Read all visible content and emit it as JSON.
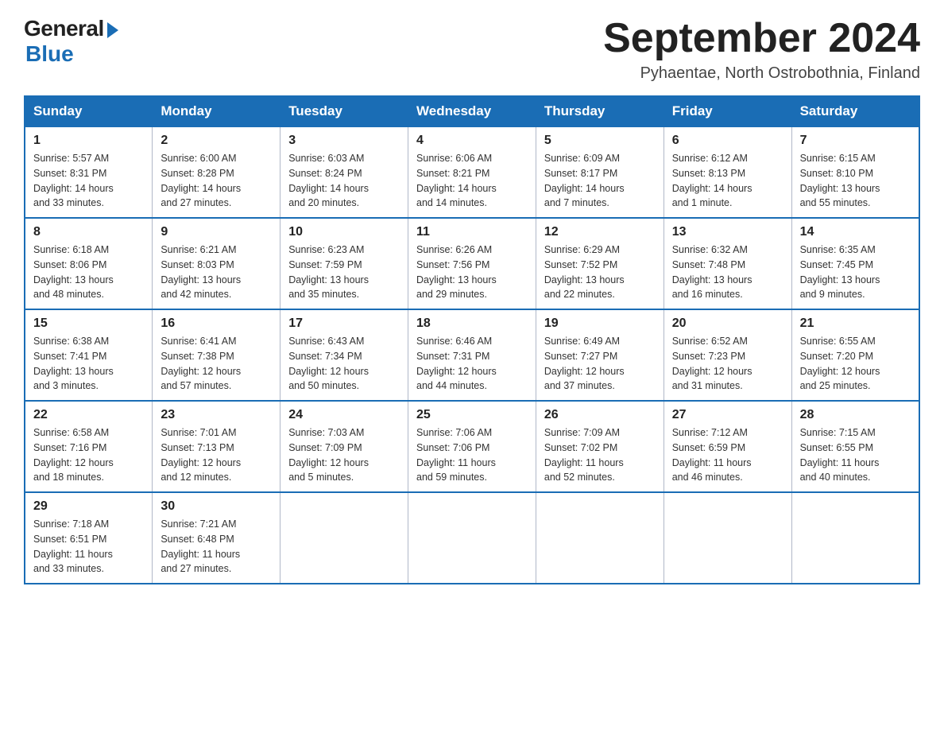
{
  "header": {
    "logo_general": "General",
    "logo_blue": "Blue",
    "month_title": "September 2024",
    "subtitle": "Pyhaentae, North Ostrobothnia, Finland"
  },
  "weekdays": [
    "Sunday",
    "Monday",
    "Tuesday",
    "Wednesday",
    "Thursday",
    "Friday",
    "Saturday"
  ],
  "weeks": [
    [
      {
        "day": "1",
        "sunrise": "Sunrise: 5:57 AM",
        "sunset": "Sunset: 8:31 PM",
        "daylight": "Daylight: 14 hours",
        "daylight2": "and 33 minutes."
      },
      {
        "day": "2",
        "sunrise": "Sunrise: 6:00 AM",
        "sunset": "Sunset: 8:28 PM",
        "daylight": "Daylight: 14 hours",
        "daylight2": "and 27 minutes."
      },
      {
        "day": "3",
        "sunrise": "Sunrise: 6:03 AM",
        "sunset": "Sunset: 8:24 PM",
        "daylight": "Daylight: 14 hours",
        "daylight2": "and 20 minutes."
      },
      {
        "day": "4",
        "sunrise": "Sunrise: 6:06 AM",
        "sunset": "Sunset: 8:21 PM",
        "daylight": "Daylight: 14 hours",
        "daylight2": "and 14 minutes."
      },
      {
        "day": "5",
        "sunrise": "Sunrise: 6:09 AM",
        "sunset": "Sunset: 8:17 PM",
        "daylight": "Daylight: 14 hours",
        "daylight2": "and 7 minutes."
      },
      {
        "day": "6",
        "sunrise": "Sunrise: 6:12 AM",
        "sunset": "Sunset: 8:13 PM",
        "daylight": "Daylight: 14 hours",
        "daylight2": "and 1 minute."
      },
      {
        "day": "7",
        "sunrise": "Sunrise: 6:15 AM",
        "sunset": "Sunset: 8:10 PM",
        "daylight": "Daylight: 13 hours",
        "daylight2": "and 55 minutes."
      }
    ],
    [
      {
        "day": "8",
        "sunrise": "Sunrise: 6:18 AM",
        "sunset": "Sunset: 8:06 PM",
        "daylight": "Daylight: 13 hours",
        "daylight2": "and 48 minutes."
      },
      {
        "day": "9",
        "sunrise": "Sunrise: 6:21 AM",
        "sunset": "Sunset: 8:03 PM",
        "daylight": "Daylight: 13 hours",
        "daylight2": "and 42 minutes."
      },
      {
        "day": "10",
        "sunrise": "Sunrise: 6:23 AM",
        "sunset": "Sunset: 7:59 PM",
        "daylight": "Daylight: 13 hours",
        "daylight2": "and 35 minutes."
      },
      {
        "day": "11",
        "sunrise": "Sunrise: 6:26 AM",
        "sunset": "Sunset: 7:56 PM",
        "daylight": "Daylight: 13 hours",
        "daylight2": "and 29 minutes."
      },
      {
        "day": "12",
        "sunrise": "Sunrise: 6:29 AM",
        "sunset": "Sunset: 7:52 PM",
        "daylight": "Daylight: 13 hours",
        "daylight2": "and 22 minutes."
      },
      {
        "day": "13",
        "sunrise": "Sunrise: 6:32 AM",
        "sunset": "Sunset: 7:48 PM",
        "daylight": "Daylight: 13 hours",
        "daylight2": "and 16 minutes."
      },
      {
        "day": "14",
        "sunrise": "Sunrise: 6:35 AM",
        "sunset": "Sunset: 7:45 PM",
        "daylight": "Daylight: 13 hours",
        "daylight2": "and 9 minutes."
      }
    ],
    [
      {
        "day": "15",
        "sunrise": "Sunrise: 6:38 AM",
        "sunset": "Sunset: 7:41 PM",
        "daylight": "Daylight: 13 hours",
        "daylight2": "and 3 minutes."
      },
      {
        "day": "16",
        "sunrise": "Sunrise: 6:41 AM",
        "sunset": "Sunset: 7:38 PM",
        "daylight": "Daylight: 12 hours",
        "daylight2": "and 57 minutes."
      },
      {
        "day": "17",
        "sunrise": "Sunrise: 6:43 AM",
        "sunset": "Sunset: 7:34 PM",
        "daylight": "Daylight: 12 hours",
        "daylight2": "and 50 minutes."
      },
      {
        "day": "18",
        "sunrise": "Sunrise: 6:46 AM",
        "sunset": "Sunset: 7:31 PM",
        "daylight": "Daylight: 12 hours",
        "daylight2": "and 44 minutes."
      },
      {
        "day": "19",
        "sunrise": "Sunrise: 6:49 AM",
        "sunset": "Sunset: 7:27 PM",
        "daylight": "Daylight: 12 hours",
        "daylight2": "and 37 minutes."
      },
      {
        "day": "20",
        "sunrise": "Sunrise: 6:52 AM",
        "sunset": "Sunset: 7:23 PM",
        "daylight": "Daylight: 12 hours",
        "daylight2": "and 31 minutes."
      },
      {
        "day": "21",
        "sunrise": "Sunrise: 6:55 AM",
        "sunset": "Sunset: 7:20 PM",
        "daylight": "Daylight: 12 hours",
        "daylight2": "and 25 minutes."
      }
    ],
    [
      {
        "day": "22",
        "sunrise": "Sunrise: 6:58 AM",
        "sunset": "Sunset: 7:16 PM",
        "daylight": "Daylight: 12 hours",
        "daylight2": "and 18 minutes."
      },
      {
        "day": "23",
        "sunrise": "Sunrise: 7:01 AM",
        "sunset": "Sunset: 7:13 PM",
        "daylight": "Daylight: 12 hours",
        "daylight2": "and 12 minutes."
      },
      {
        "day": "24",
        "sunrise": "Sunrise: 7:03 AM",
        "sunset": "Sunset: 7:09 PM",
        "daylight": "Daylight: 12 hours",
        "daylight2": "and 5 minutes."
      },
      {
        "day": "25",
        "sunrise": "Sunrise: 7:06 AM",
        "sunset": "Sunset: 7:06 PM",
        "daylight": "Daylight: 11 hours",
        "daylight2": "and 59 minutes."
      },
      {
        "day": "26",
        "sunrise": "Sunrise: 7:09 AM",
        "sunset": "Sunset: 7:02 PM",
        "daylight": "Daylight: 11 hours",
        "daylight2": "and 52 minutes."
      },
      {
        "day": "27",
        "sunrise": "Sunrise: 7:12 AM",
        "sunset": "Sunset: 6:59 PM",
        "daylight": "Daylight: 11 hours",
        "daylight2": "and 46 minutes."
      },
      {
        "day": "28",
        "sunrise": "Sunrise: 7:15 AM",
        "sunset": "Sunset: 6:55 PM",
        "daylight": "Daylight: 11 hours",
        "daylight2": "and 40 minutes."
      }
    ],
    [
      {
        "day": "29",
        "sunrise": "Sunrise: 7:18 AM",
        "sunset": "Sunset: 6:51 PM",
        "daylight": "Daylight: 11 hours",
        "daylight2": "and 33 minutes."
      },
      {
        "day": "30",
        "sunrise": "Sunrise: 7:21 AM",
        "sunset": "Sunset: 6:48 PM",
        "daylight": "Daylight: 11 hours",
        "daylight2": "and 27 minutes."
      },
      null,
      null,
      null,
      null,
      null
    ]
  ]
}
